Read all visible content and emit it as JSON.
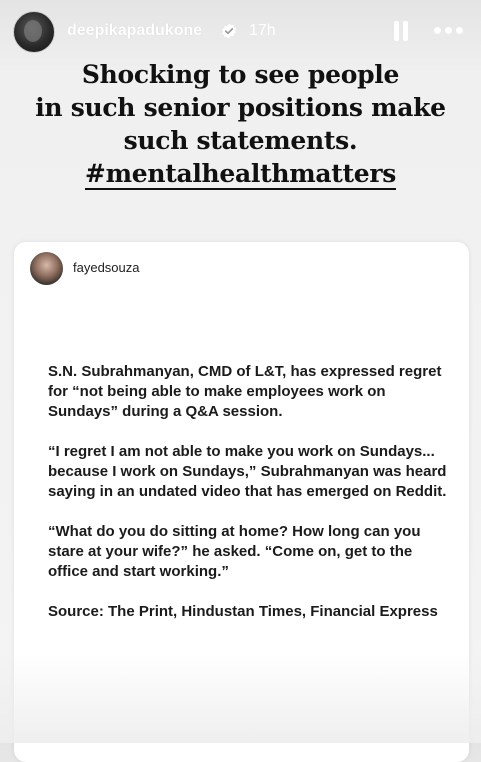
{
  "header": {
    "username": "deepikapadukone",
    "time": "17h",
    "verified_icon": "verified-badge-icon",
    "pause_icon": "pause-icon",
    "more_icon": "more-options-icon"
  },
  "headline": {
    "line1": "Shocking to see people",
    "line2": "in such senior positions make",
    "line3": "such statements.",
    "hashtag": "#mentalhealthmatters"
  },
  "shared_post": {
    "username": "fayedsouza",
    "paragraphs": [
      "S.N. Subrahmanyan, CMD of L&T, has expressed regret for “not being able to make employees work on Sundays” during a Q&A session.",
      "“I regret I am not able to make you work on Sundays... because I work on Sundays,” Subrahmanyan was heard saying in an undated video that has emerged on Reddit.",
      "“What do you do sitting at home? How long can you stare at your wife?” he asked. “Come on, get to the office and start working.”",
      "Source: The Print, Hindustan Times, Financial Express"
    ]
  },
  "colors": {
    "background": "#f0f0f0",
    "card": "#ffffff",
    "text": "#111111",
    "header_text": "#ffffff"
  }
}
